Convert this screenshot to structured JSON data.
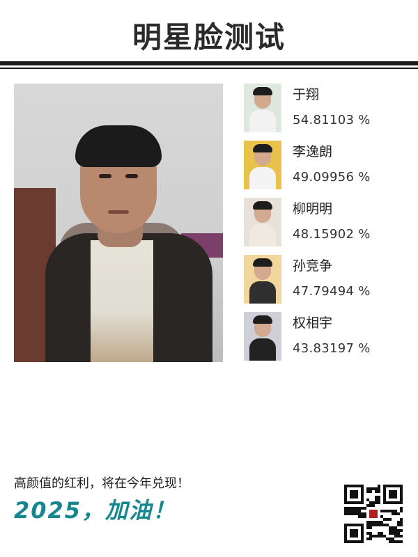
{
  "header": {
    "title": "明星脸测试"
  },
  "photo": {
    "icon": "user-portrait-photo"
  },
  "matches": [
    {
      "name": "于翔",
      "score": "54.81103 %",
      "thumb_bg": "#dfe8de",
      "thumb_body": "#f2f2f2"
    },
    {
      "name": "李逸朗",
      "score": "49.09956 %",
      "thumb_bg": "#e8c24a",
      "thumb_body": "#f4f4f4"
    },
    {
      "name": "柳明明",
      "score": "48.15902 %",
      "thumb_bg": "#e7e1da",
      "thumb_body": "#efe9df"
    },
    {
      "name": "孙竞争",
      "score": "47.79494 %",
      "thumb_bg": "#f1d79c",
      "thumb_body": "#2f2f2f"
    },
    {
      "name": "权相宇",
      "score": "43.83197 %",
      "thumb_bg": "#cfcfd8",
      "thumb_body": "#222222"
    }
  ],
  "footer": {
    "slogan": "高颜值的红利，将在今年兑现！",
    "cheer": "2025，加油！",
    "qr_icon": "qr-code-icon"
  },
  "colors": {
    "accent": "#17878f",
    "rule": "#1a1a1a"
  }
}
